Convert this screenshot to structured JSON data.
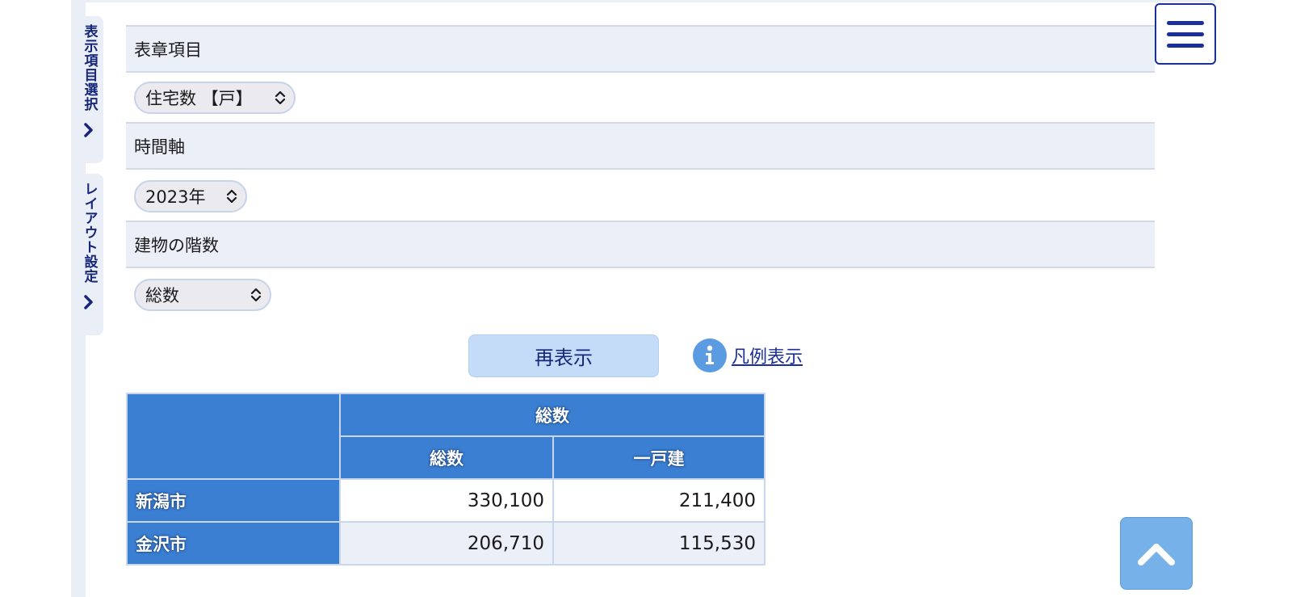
{
  "sidebar": {
    "tab_items_label": "表示項目選択",
    "tab_layout_label": "レイアウト設定"
  },
  "filters": {
    "table_item": {
      "label": "表章項目",
      "value": "住宅数 【戸】"
    },
    "time_axis": {
      "label": "時間軸",
      "value": "2023年"
    },
    "building_floors": {
      "label": "建物の階数",
      "value": "総数"
    }
  },
  "actions": {
    "redisplay_label": "再表示",
    "legend_label": "凡例表示"
  },
  "table": {
    "group_header": "総数",
    "columns": [
      "総数",
      "一戸建"
    ],
    "rows": [
      {
        "name": "新潟市",
        "values": [
          "330,100",
          "211,400"
        ]
      },
      {
        "name": "金沢市",
        "values": [
          "206,710",
          "115,530"
        ]
      }
    ]
  },
  "icons": {
    "menu": "hamburger-menu-icon",
    "back_to_top": "chevron-up-icon",
    "info": "info-icon",
    "sidebar_chevron": "chevron-right-icon",
    "select_caret": "up-down-caret-icon"
  },
  "colors": {
    "accent_navy": "#1b2f9a",
    "table_header_blue": "#3b7fd3",
    "row_band": "#eaeff8",
    "button_light_blue": "#c5dcf8",
    "to_top_blue": "#76b1ea"
  }
}
